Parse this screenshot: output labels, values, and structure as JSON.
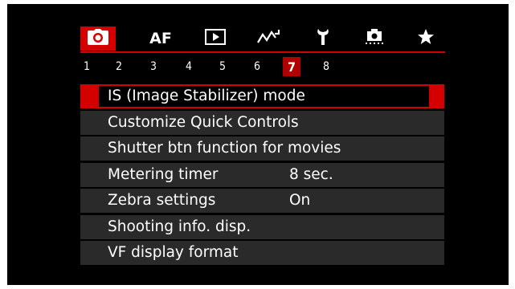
{
  "tabs": [
    {
      "icon": "camera-icon",
      "label": "",
      "active": true
    },
    {
      "icon": "",
      "label": "AF",
      "active": false
    },
    {
      "icon": "playback-icon",
      "label": "",
      "active": false
    },
    {
      "icon": "wireless-icon",
      "label": "",
      "active": false
    },
    {
      "icon": "wrench-icon",
      "label": "",
      "active": false
    },
    {
      "icon": "custom-function-icon",
      "label": "",
      "active": false
    },
    {
      "icon": "star-icon",
      "label": "",
      "active": false
    }
  ],
  "pages": [
    "1",
    "2",
    "3",
    "4",
    "5",
    "6",
    "7",
    "8"
  ],
  "active_page": "7",
  "menu": {
    "items": [
      {
        "label": "IS (Image Stabilizer) mode",
        "value": "",
        "selected": true
      },
      {
        "label": "Customize Quick Controls",
        "value": "",
        "selected": false
      },
      {
        "label": "Shutter btn function for movies",
        "value": "",
        "selected": false
      },
      {
        "label": "Metering timer",
        "value": "8 sec.",
        "selected": false
      },
      {
        "label": "Zebra settings",
        "value": "On",
        "selected": false
      },
      {
        "label": "Shooting info. disp.",
        "value": "",
        "selected": false
      },
      {
        "label": "VF display format",
        "value": "",
        "selected": false
      }
    ]
  },
  "colors": {
    "accent": "#d40000",
    "background": "#000000",
    "row": "#2a2a2a",
    "text": "#ffffff"
  }
}
